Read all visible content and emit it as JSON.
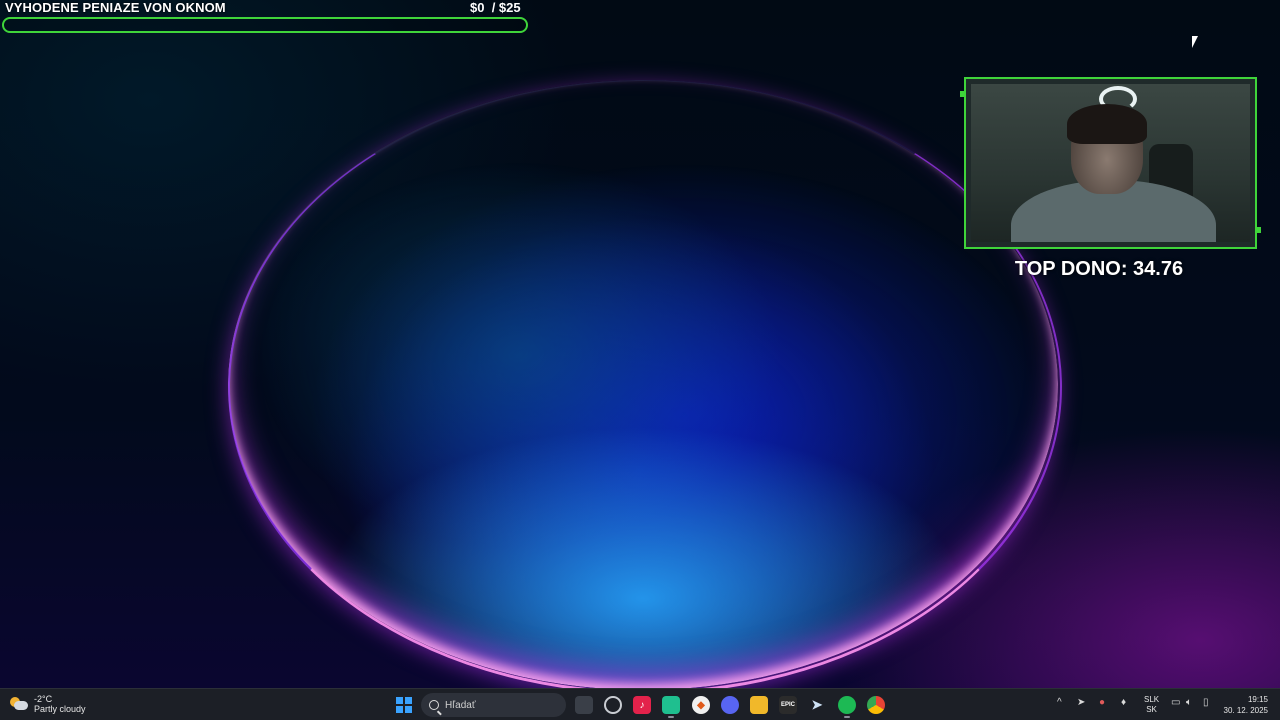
{
  "overlay": {
    "goal_title": "VYHODENE PENIAZE VON OKNOM",
    "goal_current": "$0",
    "goal_target": "  / $25",
    "goal_progress_fraction": 0,
    "top_dono": "TOP DONO: 34.76",
    "accent_color": "#3fd43a"
  },
  "taskbar": {
    "weather_temp": "-2°C",
    "weather_desc": "Partly cloudy",
    "search_placeholder": "Hľadať",
    "apps": [
      {
        "name": "task-view-icon"
      },
      {
        "name": "obs-icon"
      },
      {
        "name": "tiktok-icon"
      },
      {
        "name": "twitch-icon"
      },
      {
        "name": "browser-icon"
      },
      {
        "name": "discord-icon"
      },
      {
        "name": "file-explorer-icon"
      },
      {
        "name": "epic-games-icon",
        "label": "EPIC"
      },
      {
        "name": "steam-icon"
      },
      {
        "name": "spotify-icon"
      },
      {
        "name": "chrome-icon"
      }
    ],
    "language_top": "SLK",
    "language_bottom": "SK",
    "time": "19:15",
    "date": "30. 12. 2025"
  }
}
